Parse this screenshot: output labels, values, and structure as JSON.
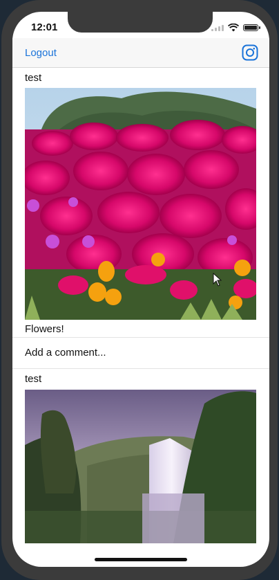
{
  "status_bar": {
    "time": "12:01"
  },
  "nav": {
    "logout_label": "Logout",
    "right_icon": "instagram-camera-icon",
    "accent": "#1a73d9"
  },
  "posts": [
    {
      "username": "test",
      "image": "pink-flowers-photo",
      "caption": "Flowers!"
    },
    {
      "username": "test",
      "image": "waterfall-photo"
    }
  ],
  "comment": {
    "placeholder": "Add a comment..."
  }
}
